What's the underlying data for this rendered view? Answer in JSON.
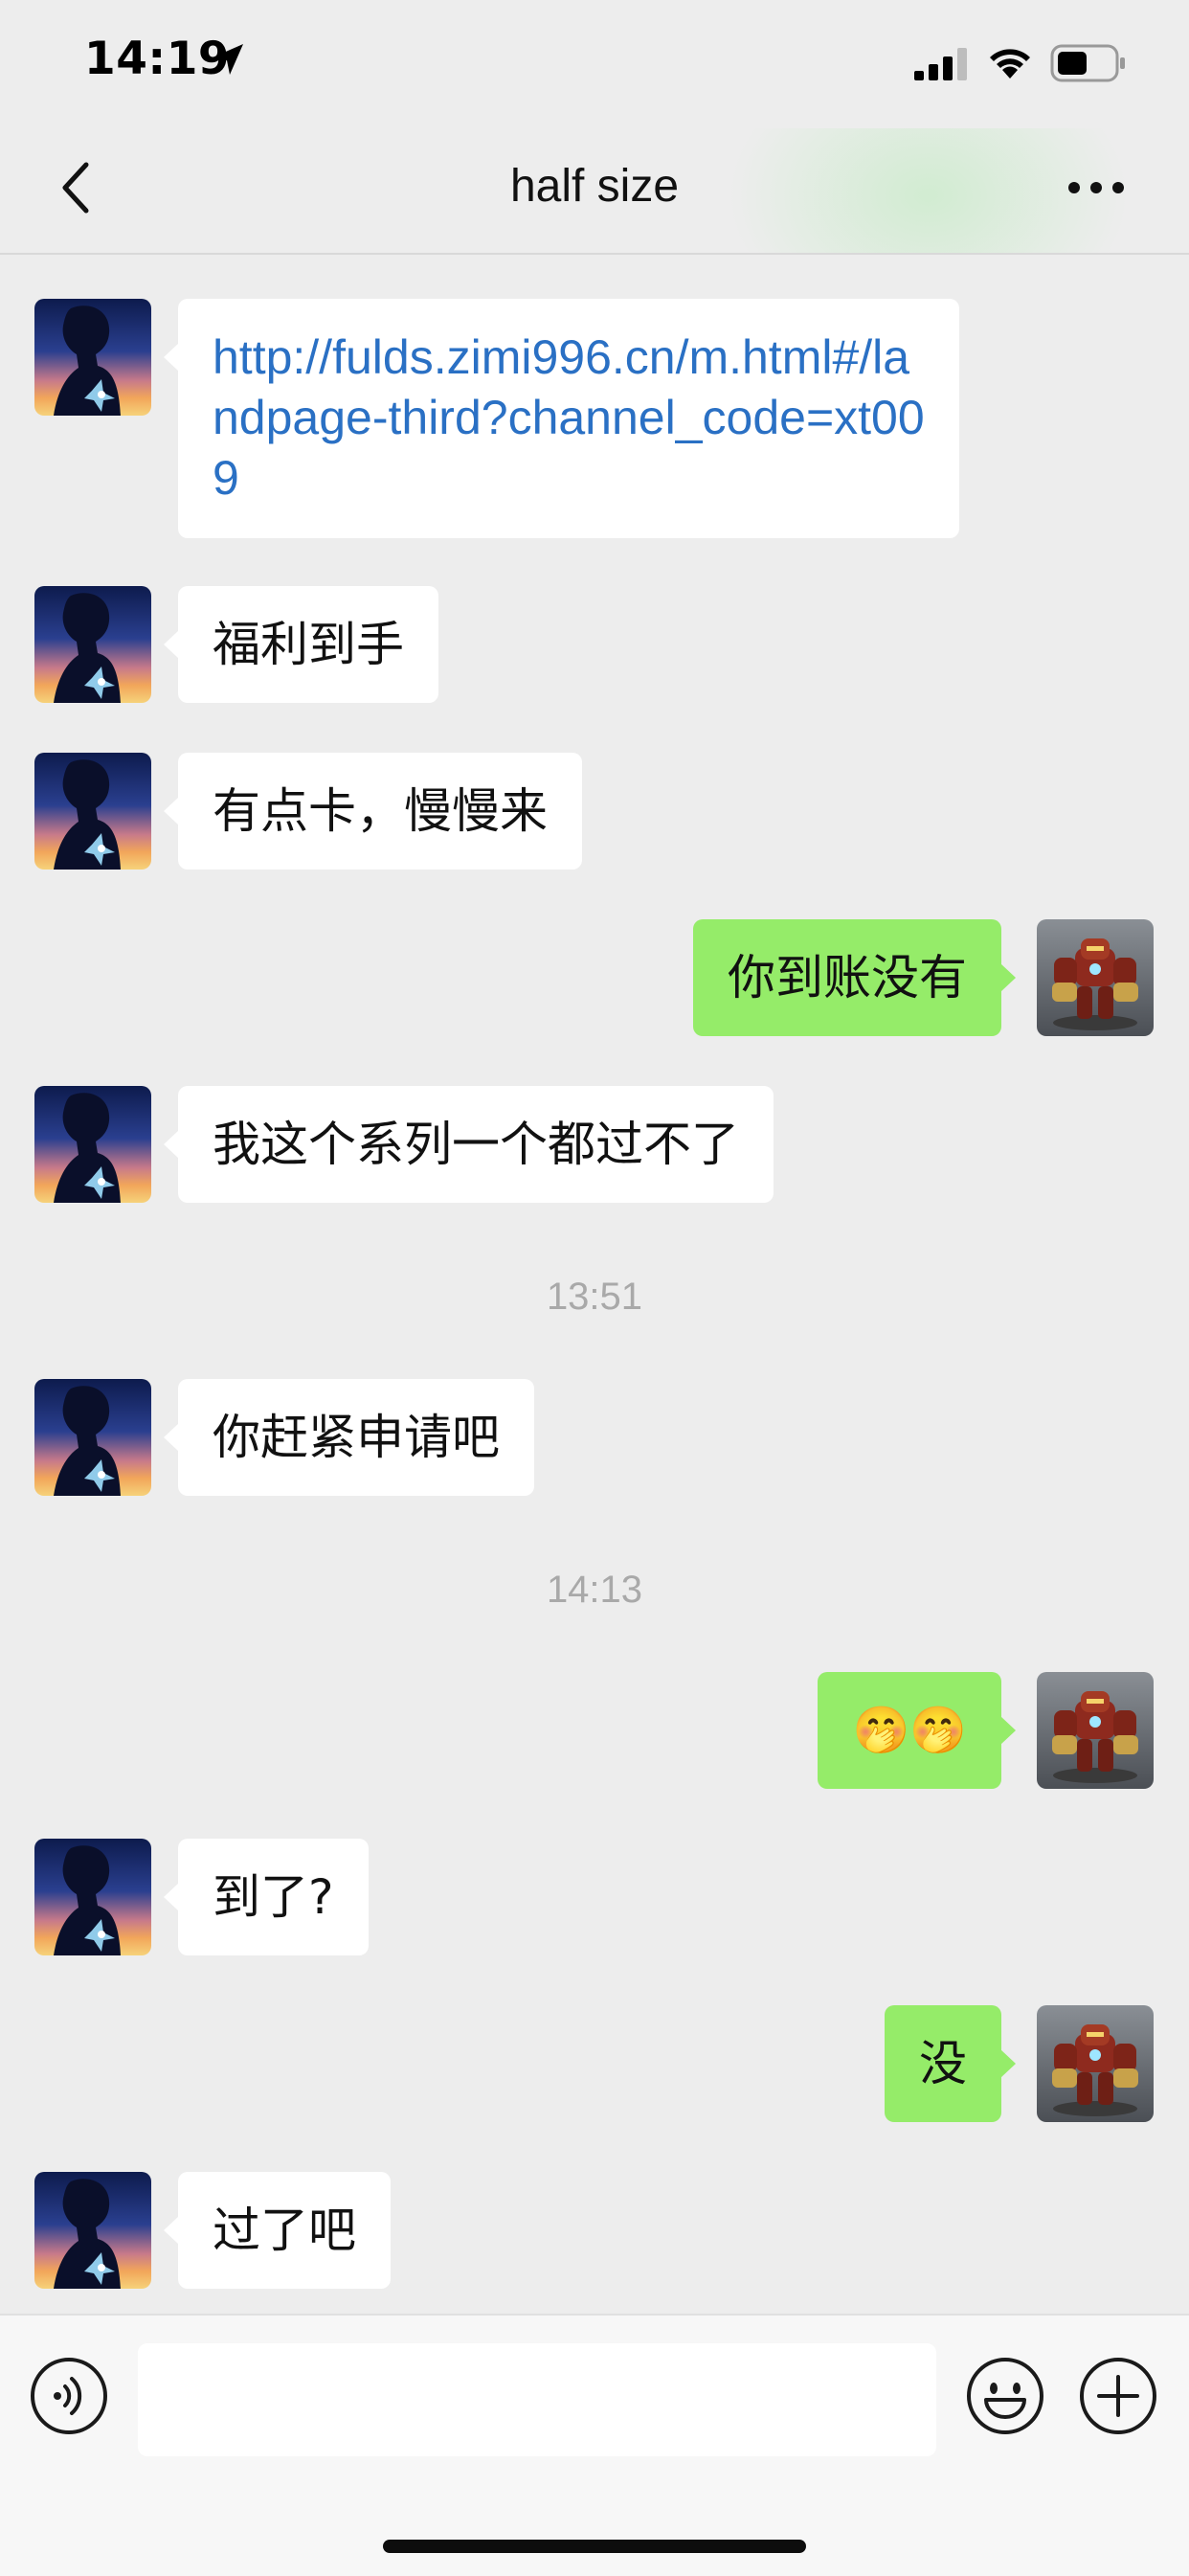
{
  "status_bar": {
    "time": "14:19"
  },
  "nav": {
    "title": "half size"
  },
  "messages": [
    {
      "side": "in",
      "kind": "link",
      "text": "http://fulds.zimi996.cn/m.html#/landpage-third?channel_code=xt009"
    },
    {
      "side": "in",
      "text": "福利到手"
    },
    {
      "side": "in",
      "text": "有点卡，慢慢来"
    },
    {
      "side": "out",
      "text": "你到账没有"
    },
    {
      "side": "in",
      "text": "我这个系列一个都过不了"
    },
    {
      "kind": "timestamp",
      "text": "13:51"
    },
    {
      "side": "in",
      "text": "你赶紧申请吧"
    },
    {
      "kind": "timestamp",
      "text": "14:13"
    },
    {
      "side": "out",
      "kind": "emoji",
      "text": "🤭🤭"
    },
    {
      "side": "in",
      "text": "到了?"
    },
    {
      "side": "out",
      "text": "没"
    },
    {
      "side": "in",
      "text": "过了吧"
    }
  ],
  "input_bar": {
    "value": "",
    "placeholder": ""
  },
  "colors": {
    "background": "#ededed",
    "incoming_bubble": "#ffffff",
    "outgoing_bubble": "#95ec69",
    "link": "#2a70c4",
    "timestamp": "#a9a9a9"
  },
  "icons": [
    "location-arrow-icon",
    "signal-icon",
    "wifi-icon",
    "battery-icon",
    "back-icon",
    "more-icon",
    "voice-icon",
    "emoji-icon",
    "plus-icon"
  ]
}
